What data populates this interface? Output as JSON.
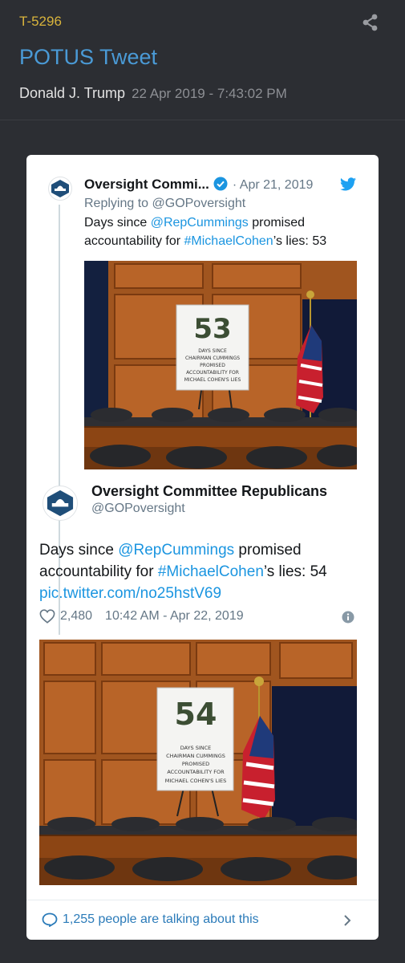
{
  "header": {
    "post_id": "T-5296",
    "title": "POTUS Tweet",
    "author": "Donald J. Trump",
    "datetime": "22 Apr 2019 - 7:43:02 PM"
  },
  "quoted_tweet": {
    "name": "Oversight Commi...",
    "date": "· Apr 21, 2019",
    "reply_prefix": "Replying to ",
    "reply_handle": "@GOPoversight",
    "text_before": "Days since ",
    "mention": "@RepCummings",
    "text_mid1": " promised accountability for ",
    "hashtag": "#MichaelCohen",
    "text_end": "’s lies: 53",
    "photo": {
      "number": "53",
      "sign_lines": [
        "DAYS SINCE",
        "CHAIRMAN CUMMINGS",
        "PROMISED",
        "ACCOUNTABILITY FOR",
        "MICHAEL COHEN'S LIES"
      ]
    }
  },
  "main_tweet": {
    "name": "Oversight Committee Republicans",
    "handle": "@GOPoversight",
    "text_before": "Days since ",
    "mention": "@RepCummings",
    "text_mid1": " promised accountability for ",
    "hashtag": "#MichaelCohen",
    "text_end": "’s lies: 54",
    "pic_link": "pic.twitter.com/no25hstV69",
    "likes": "2,480",
    "timestamp": "10:42 AM - Apr 22, 2019",
    "photo": {
      "number": "54",
      "sign_lines": [
        "DAYS SINCE",
        "CHAIRMAN CUMMINGS",
        "PROMISED",
        "ACCOUNTABILITY FOR",
        "MICHAEL COHEN'S LIES"
      ]
    }
  },
  "footer": {
    "talking": "1,255 people are talking about this"
  },
  "colors": {
    "background": "#2c2e33",
    "post_id": "#d9b43c",
    "title": "#4a9ad6",
    "twitter_blue": "#1b95e0"
  },
  "icons": [
    "share-icon",
    "verified-icon",
    "twitter-bird-icon",
    "heart-icon",
    "info-icon",
    "speech-bubble-icon",
    "chevron-right-icon"
  ]
}
